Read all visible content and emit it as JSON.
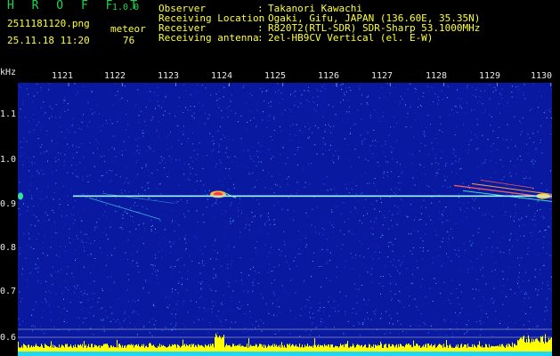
{
  "app": {
    "title": "H R O F F T",
    "version": "1.0.0"
  },
  "capture": {
    "filename": "2511181120.png",
    "datetime": "25.11.18 11:20",
    "mode": "meteor",
    "count": "76"
  },
  "info": [
    {
      "label": "Observer",
      "value": "Takanori Kawachi"
    },
    {
      "label": "Receiving Location",
      "value": "Ogaki, Gifu, JAPAN (136.60E, 35.35N)"
    },
    {
      "label": "Receiver",
      "value": "R820T2(RTL-SDR) SDR-Sharp 53.1000MHz"
    },
    {
      "label": "Receiving antenna",
      "value": "2el-HB9CV Vertical (el. E-W)"
    }
  ],
  "separator": ":",
  "chart_data": {
    "type": "heatmap",
    "y_unit": "kHz",
    "x_ticks": [
      "1121",
      "1122",
      "1123",
      "1124",
      "1125",
      "1126",
      "1127",
      "1128",
      "1129",
      "1130"
    ],
    "y_ticks": [
      "1.1",
      "1.0",
      "0.9",
      "0.8",
      "0.7",
      "0.6"
    ],
    "ylim": [
      0.57,
      1.15
    ],
    "carrier_khz": 0.92,
    "colors": {
      "background": "#0a1aa0",
      "carrier": "#9ff5ff",
      "echo": "#ff3a3a",
      "level_bar": "#ffff00",
      "level_base": "#22d6f5"
    }
  }
}
